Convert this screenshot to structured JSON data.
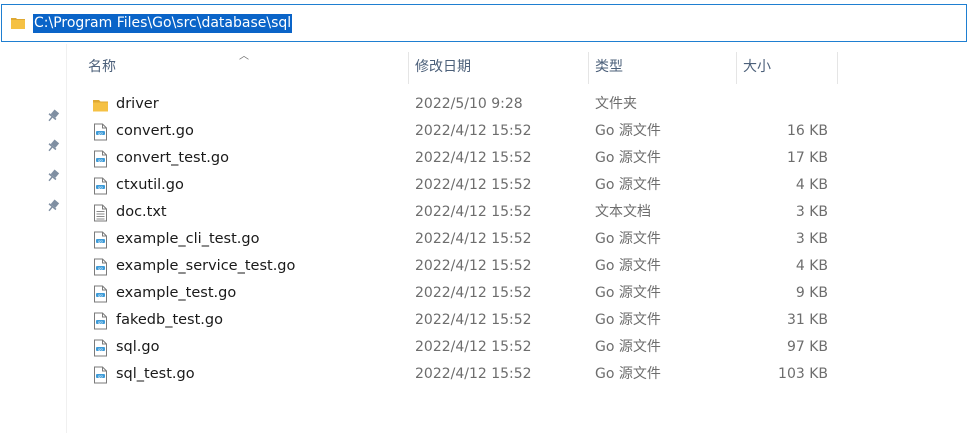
{
  "address_bar": {
    "path": "C:\\Program Files\\Go\\src\\database\\sql"
  },
  "columns": {
    "name": "名称",
    "date": "修改日期",
    "type": "类型",
    "size": "大小"
  },
  "quick_access_pins": [
    "pin-icon",
    "pin-icon",
    "pin-icon",
    "pin-icon"
  ],
  "files": [
    {
      "name": "driver",
      "date": "2022/5/10 9:28",
      "type": "文件夹",
      "size": "",
      "icon": "folder"
    },
    {
      "name": "convert.go",
      "date": "2022/4/12 15:52",
      "type": "Go 源文件",
      "size": "16 KB",
      "icon": "go-file"
    },
    {
      "name": "convert_test.go",
      "date": "2022/4/12 15:52",
      "type": "Go 源文件",
      "size": "17 KB",
      "icon": "go-file"
    },
    {
      "name": "ctxutil.go",
      "date": "2022/4/12 15:52",
      "type": "Go 源文件",
      "size": "4 KB",
      "icon": "go-file"
    },
    {
      "name": "doc.txt",
      "date": "2022/4/12 15:52",
      "type": "文本文档",
      "size": "3 KB",
      "icon": "text-file"
    },
    {
      "name": "example_cli_test.go",
      "date": "2022/4/12 15:52",
      "type": "Go 源文件",
      "size": "3 KB",
      "icon": "go-file"
    },
    {
      "name": "example_service_test.go",
      "date": "2022/4/12 15:52",
      "type": "Go 源文件",
      "size": "4 KB",
      "icon": "go-file"
    },
    {
      "name": "example_test.go",
      "date": "2022/4/12 15:52",
      "type": "Go 源文件",
      "size": "9 KB",
      "icon": "go-file"
    },
    {
      "name": "fakedb_test.go",
      "date": "2022/4/12 15:52",
      "type": "Go 源文件",
      "size": "31 KB",
      "icon": "go-file"
    },
    {
      "name": "sql.go",
      "date": "2022/4/12 15:52",
      "type": "Go 源文件",
      "size": "97 KB",
      "icon": "go-file"
    },
    {
      "name": "sql_test.go",
      "date": "2022/4/12 15:52",
      "type": "Go 源文件",
      "size": "103 KB",
      "icon": "go-file"
    }
  ],
  "colors": {
    "selection": "#0a64c8",
    "address_border": "#1f7fd1",
    "folder": "#f5c144",
    "go_badge": "#3d9bd8"
  }
}
